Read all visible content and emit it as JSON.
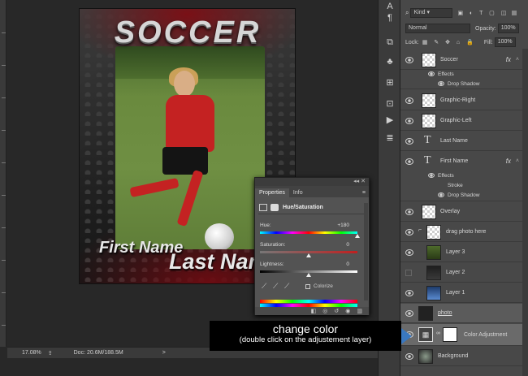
{
  "canvas": {
    "title_text": "SOCCER",
    "first_name": "First Name",
    "last_name": "Last Nam"
  },
  "status_bar": {
    "zoom": "17.08%",
    "doc": "Doc: 20.6M/188.5M",
    "arrow": ">"
  },
  "layers_panel": {
    "kind_filter": "Kind",
    "blend_mode": "Normal",
    "opacity_label": "Opacity:",
    "opacity_value": "100%",
    "lock_label": "Lock:",
    "fill_label": "Fill:",
    "fill_value": "100%",
    "layers": [
      {
        "name": "Soccer",
        "fx": "fx"
      },
      {
        "name": "Effects"
      },
      {
        "name": "Drop Shadow"
      },
      {
        "name": "Graphic-Right"
      },
      {
        "name": "Graphic-Left"
      },
      {
        "name": "Last Name"
      },
      {
        "name": "First Name",
        "fx": "fx"
      },
      {
        "name": "Effects"
      },
      {
        "name": "Stroke"
      },
      {
        "name": "Drop Shadow"
      },
      {
        "name": "Overlay"
      },
      {
        "name": "drag photo here"
      },
      {
        "name": "Layer 3"
      },
      {
        "name": "Layer 2"
      },
      {
        "name": "Layer 1"
      },
      {
        "name": "photo"
      },
      {
        "name": "Color Adjustment"
      },
      {
        "name": "Background"
      }
    ]
  },
  "properties_panel": {
    "tab_properties": "Properties",
    "tab_info": "Info",
    "adjustment_title": "Hue/Saturation",
    "hue_label": "Hue:",
    "hue_value": "+180",
    "saturation_label": "Saturation:",
    "saturation_value": "0",
    "lightness_label": "Lightness:",
    "lightness_value": "0",
    "colorize_label": "Colorize",
    "hue_level": 1.0,
    "saturation_level": 0.5,
    "lightness_level": 0.5
  },
  "callout": {
    "line1": "change color",
    "line2": "(double click on the adjustement layer)"
  },
  "colors": {
    "accent_selected": "#3a78c0",
    "shirt_red": "#c42222"
  }
}
